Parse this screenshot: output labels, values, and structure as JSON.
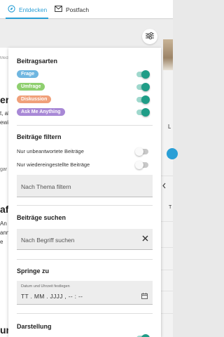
{
  "nav": {
    "tabs": [
      {
        "label": "Entdecken",
        "icon": "compass-icon",
        "active": true
      },
      {
        "label": "Postfach",
        "icon": "mail-icon",
        "active": false
      }
    ],
    "accent": "#2a9fd6"
  },
  "background": {
    "frag_medi": "Medi",
    "frag_ers": "ers",
    "frag_t_al": "t, al",
    "frag_ewi": "ewi",
    "frag_gar": "gar",
    "frag_afe": "afe",
    "frag_an": "An",
    "frag_ann": "ann",
    "frag_e": "e",
    "frag_un": "un",
    "right_l": "L",
    "right_t": "T"
  },
  "panel": {
    "types": {
      "title": "Beitragsarten",
      "items": [
        {
          "label": "Frage",
          "color": "#6fb6e0",
          "on": true
        },
        {
          "label": "Umfrage",
          "color": "#8fcf6f",
          "on": true
        },
        {
          "label": "Diskussion",
          "color": "#f0a07a",
          "on": true
        },
        {
          "label": "Ask Me Anything",
          "color": "#a888d6",
          "on": true
        }
      ]
    },
    "filter": {
      "title": "Beiträge filtern",
      "options": [
        {
          "label": "Nur unbeantwortete Beiträge",
          "on": false
        },
        {
          "label": "Nur wiedereingestellte Beiträge",
          "on": false
        }
      ],
      "topic_placeholder": "Nach Thema filtern"
    },
    "search": {
      "title": "Beiträge suchen",
      "placeholder": "Nach Begriff suchen"
    },
    "jump": {
      "title": "Springe zu",
      "field_label": "Datum und Uhrzeit festlegen",
      "value": "TT . MM . JJJJ ,  -- : --"
    },
    "display": {
      "title": "Darstellung"
    },
    "toggle_on_color": "#1f9d87"
  }
}
